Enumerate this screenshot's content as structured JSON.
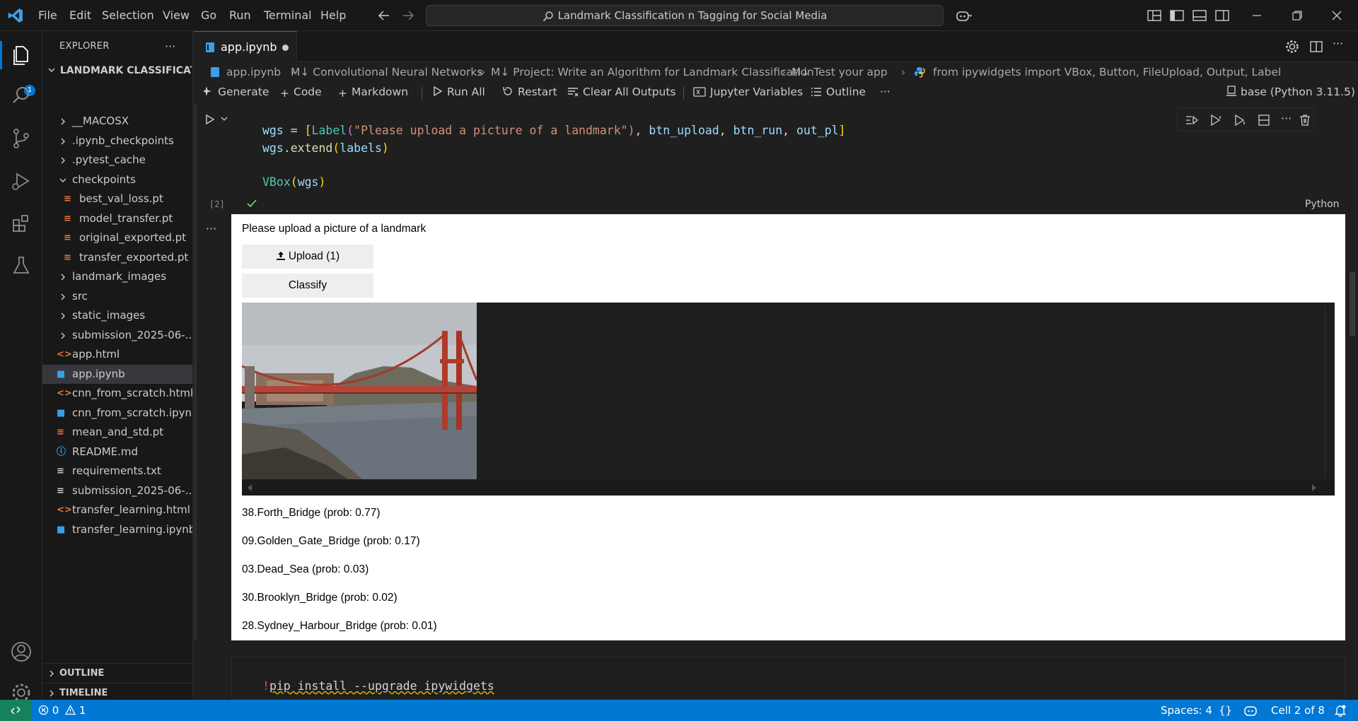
{
  "menu": [
    "File",
    "Edit",
    "Selection",
    "View",
    "Go",
    "Run",
    "Terminal",
    "Help"
  ],
  "command_center": "Landmark Classification n Tagging for Social Media",
  "activity": {
    "badge": "1"
  },
  "explorer": {
    "title": "EXPLORER",
    "folder": "LANDMARK CLASSIFICATI...",
    "items": [
      {
        "name": "__MACOSX",
        "type": "folder"
      },
      {
        "name": ".ipynb_checkpoints",
        "type": "folder"
      },
      {
        "name": ".pytest_cache",
        "type": "folder"
      },
      {
        "name": "checkpoints",
        "type": "folder-open"
      },
      {
        "name": "best_val_loss.pt",
        "type": "pt"
      },
      {
        "name": "model_transfer.pt",
        "type": "pt"
      },
      {
        "name": "original_exported.pt",
        "type": "pt"
      },
      {
        "name": "transfer_exported.pt",
        "type": "pt"
      },
      {
        "name": "landmark_images",
        "type": "folder"
      },
      {
        "name": "src",
        "type": "folder"
      },
      {
        "name": "static_images",
        "type": "folder"
      },
      {
        "name": "submission_2025-06-...",
        "type": "folder"
      },
      {
        "name": "app.html",
        "type": "html"
      },
      {
        "name": "app.ipynb",
        "type": "ipynb"
      },
      {
        "name": "cnn_from_scratch.html",
        "type": "html"
      },
      {
        "name": "cnn_from_scratch.ipynb",
        "type": "ipynb"
      },
      {
        "name": "mean_and_std.pt",
        "type": "pt"
      },
      {
        "name": "README.md",
        "type": "info"
      },
      {
        "name": "requirements.txt",
        "type": "txt"
      },
      {
        "name": "submission_2025-06-...",
        "type": "txt"
      },
      {
        "name": "transfer_learning.html",
        "type": "html"
      },
      {
        "name": "transfer_learning.ipynb",
        "type": "ipynb"
      }
    ],
    "outline": "OUTLINE",
    "timeline": "TIMELINE"
  },
  "tab": {
    "label": "app.ipynb"
  },
  "breadcrumb": [
    "app.ipynb",
    "M↓ Convolutional Neural Networks",
    "M↓ Project: Write an Algorithm for Landmark Classification",
    "M↓ Test your app",
    "from ipywidgets import VBox, Button, FileUpload, Output, Label"
  ],
  "toolbar": {
    "generate": "Generate",
    "code": "Code",
    "markdown": "Markdown",
    "run_all": "Run All",
    "restart": "Restart",
    "clear": "Clear All Outputs",
    "variables": "Jupyter Variables",
    "outline": "Outline",
    "kernel": "base (Python 3.11.5)"
  },
  "cell": {
    "exec_count": "[2]",
    "language": "Python"
  },
  "output": {
    "label": "Please upload a picture of a landmark",
    "upload_btn": "Upload (1)",
    "classify_btn": "Classify",
    "predictions": [
      "38.Forth_Bridge (prob: 0.77)",
      "09.Golden_Gate_Bridge (prob: 0.17)",
      "03.Dead_Sea (prob: 0.03)",
      "30.Brooklyn_Bridge (prob: 0.02)",
      "28.Sydney_Harbour_Bridge (prob: 0.01)"
    ]
  },
  "cell2": {
    "code_bang": "!",
    "code_rest": "pip install --upgrade ipywidgets"
  },
  "status": {
    "errors": "0",
    "warnings": "1",
    "spaces": "Spaces: 4",
    "braces": "{}",
    "cell": "Cell 2 of 8"
  }
}
